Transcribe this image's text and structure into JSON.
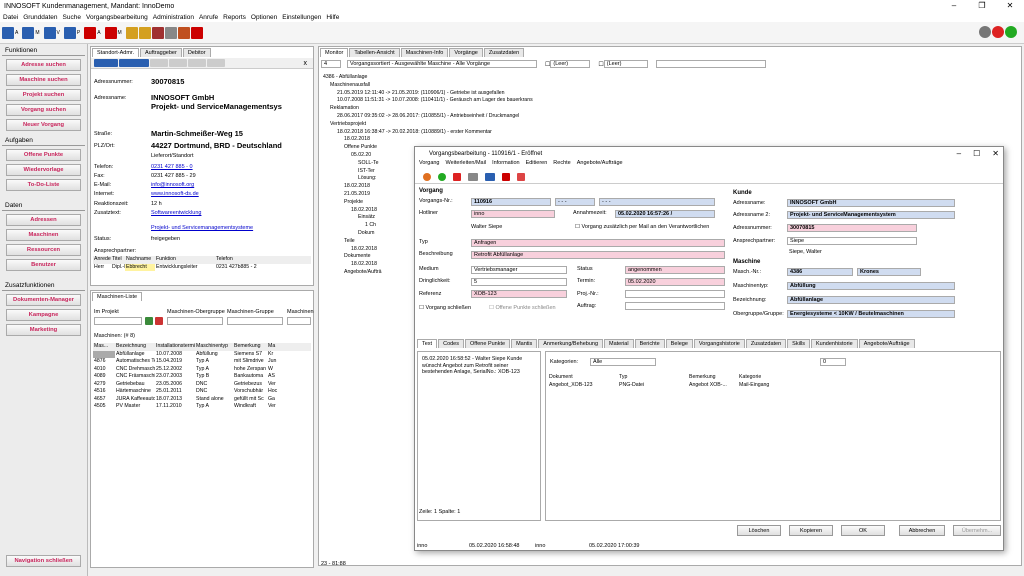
{
  "title": "INNOSOFT Kundenmanagement, Mandant: InnoDemo",
  "menu": [
    "Datei",
    "Grunddaten",
    "Suche",
    "Vorgangsbearbeitung",
    "Administration",
    "Anrufe",
    "Reports",
    "Optionen",
    "Einstellungen",
    "Hilfe"
  ],
  "toolbar": {
    "labels": [
      "A",
      "M",
      "V",
      "P",
      "A",
      "M"
    ]
  },
  "nav": {
    "funktionen": "Funktionen",
    "btns1": [
      "Adresse suchen",
      "Maschine suchen",
      "Projekt suchen",
      "Vorgang suchen",
      "Neuer Vorgang"
    ],
    "aufgaben": "Aufgaben",
    "btns2": [
      "Offene Punkte",
      "Wiedervorlage",
      "To-Do-Liste"
    ],
    "daten": "Daten",
    "btns3": [
      "Adressen",
      "Maschinen",
      "Ressourcen",
      "Benutzer"
    ],
    "zusatz": "Zusatzfunktionen",
    "btns4": [
      "Dokumenten-Manager",
      "Kampagne",
      "Marketing"
    ],
    "close": "Navigation schließen"
  },
  "addr": {
    "tabs": [
      "Standort-Admr.",
      "Auftraggeber",
      "Debitor"
    ],
    "nr_l": "Adressnummer:",
    "nr": "30070815",
    "name_l": "Adressname:",
    "name1": "INNOSOFT GmbH",
    "name2": "Projekt- und ServiceManagementsys",
    "str_l": "Straße:",
    "str": "Martin-Schmeißer-Weg 15",
    "plz_l": "PLZ/Ort:",
    "plz": "44227 Dortmund, BRD - Deutschland",
    "typ": "Lieferort/Standort",
    "tel_l": "Telefon:",
    "tel": "0231 427 885 - 0",
    "fax_l": "Fax:",
    "fax": "0231 427 885 - 29",
    "mail_l": "E-Mail:",
    "mail": "info@innosoft.org",
    "inet_l": "Internet:",
    "inet": "www.innosoft-ds.de",
    "rz_l": "Reaktionszeit:",
    "rz": "12 h",
    "zt_l": "Zusatztext:",
    "zt": "Softwareentwicklung",
    "pl": "Projekt- und Servicemanagementsysteme",
    "status_l": "Status:",
    "status": "freigegeben",
    "ap_l": "Ansprechpartner:",
    "ap_hdr": [
      "Anrede",
      "Titel",
      "Nachname",
      "Funktion",
      "Telefon"
    ],
    "ap_row": [
      "Herr",
      "Dipl.-I",
      "Ebbrecht",
      "Entwicklungsleiter",
      "0231 427b885 - 2"
    ]
  },
  "mach": {
    "tab": "Maschinen-Liste",
    "f1": "Im Projekt",
    "f2": "Maschinen-Obergruppe",
    "f3": "Maschinen-Gruppe",
    "f4": "Maschinen",
    "count": "Maschinen: (# 8)",
    "hdr": [
      "Mas...",
      "Bezeichnung",
      "Installationstermin",
      "Maschinentyp",
      "Bemerkung",
      "Ma"
    ],
    "rows": [
      [
        "",
        "Abfüllanlage",
        "10.07.2008",
        "Abfüllung",
        "Siemens S7",
        "Kr"
      ],
      [
        "4876",
        "Automatisches Te",
        "15.04.2019",
        "Typ A",
        "mit Slimdrive",
        "Jun"
      ],
      [
        "4010",
        "CNC Drehmaschin",
        "25.12.2002",
        "Typ A",
        "hohe Zerspan",
        "W"
      ],
      [
        "4089",
        "CNC Fräsmaschin",
        "23.07.2003",
        "Typ B",
        "Bankautoma",
        "AS"
      ],
      [
        "4279",
        "Getriebebau",
        "23.05.2006",
        "DNC",
        "Getriebezus",
        "Ver"
      ],
      [
        "4516",
        "Härtemaschine",
        "25.01.2011",
        "DNC",
        "Vorschubhär",
        "Hoc"
      ],
      [
        "4657",
        "JURA Kaffeeauto",
        "18.07.2013",
        "Stand alone",
        "gefüllt mit Sc",
        "Ga"
      ],
      [
        "4505",
        "PV Master",
        "17.11.2010",
        "Typ A",
        "Windkraft",
        "Ver"
      ]
    ]
  },
  "monitor": {
    "tabs": [
      "Monitor",
      "Tabellen-Ansicht",
      "Maschinen-Info",
      "Vorgänge",
      "Zusatzdaten"
    ],
    "num": "4",
    "sort": "Vorgangssortiert - Ausgewählte Maschine - Alle Vorgänge",
    "leer1": "(Leer)",
    "leer2": "(Leer)",
    "tree": [
      "4386 - Abfüllanlage",
      "Maschinenausfall",
      "21.05.2019 12:11:40 -> 21.05.2019: (110906/1) - Getriebe ist ausgefallen",
      "10.07.2008 11:51:31 -> 10.07.2008: (110411/1) - Geräusch am Lager des bauerkrans",
      "Reklamation",
      "28.06.2017 09:35:02 -> 28.06.2017: (110855/1) - Antriebseinheit / Druckmangel",
      "Vertriebsprojekt",
      "18.02.2018 16:38:47 -> 20.02.2018: (110889/1) - erster Kommentar",
      "18.02.2018",
      "Offene Punkte",
      "05.02.20",
      "SOLL-Te",
      "IST-Ter",
      "Lösung:",
      "18.02.2018",
      "21.05.2019",
      "Projekte",
      "18.02.2018",
      "Einsätz",
      "1 Ch",
      "Dokum",
      "Teile",
      "18.02.2018",
      "Dokumente",
      "18.02.2018",
      "Angebote/Aufträ"
    ],
    "status": "23 - 81:88"
  },
  "dlg": {
    "title": "Vorgangsbearbeitung - 110916/1 - Eröffnet",
    "menu": [
      "Vorgang",
      "Weiterleiten/Mail",
      "Information",
      "Editieren",
      "Rechte",
      "Angebote/Aufträge"
    ],
    "vorgang": "Vorgang",
    "vnr_l": "Vorgangs-Nr.:",
    "vnr": "110916",
    "hotl_l": "Hotliner",
    "hotl": "inno",
    "annz_l": "Annahmezeit:",
    "annz": "05.02.2020 16:57:26 /",
    "user": "Walter Siepe",
    "chk1": "Vorgang zusätzlich per Mail an den Verantwortlichen",
    "typ_l": "Typ",
    "typ": "Anfragen",
    "bes_l": "Beschreibung",
    "bes": "Retrofit Abfüllanlage",
    "med_l": "Medium",
    "med": "Vertriebsmanager",
    "sta_l": "Status",
    "sta": "angenommen",
    "dri_l": "Dringlichkeit:",
    "dri": "5",
    "ter_l": "Termin:",
    "ter": "05.02.2020",
    "ref_l": "Referenz",
    "ref": "XOB-123",
    "proj_l": "Proj.-Nr.:",
    "auf_l": "Auftrag:",
    "chk2": "Vorgang schließen",
    "chk3": "Offene Punkte schließen",
    "kunde": "Kunde",
    "an_l": "Adressname:",
    "an": "INNOSOFT GmbH",
    "an2_l": "Adressname 2:",
    "an2": "Projekt- und ServiceManagementsystem",
    "anr_l": "Adressnummer:",
    "anr": "30070815",
    "ap_l": "Ansprechpartner:",
    "ap": "Siepe",
    "ap2": "Siepe, Walter",
    "masch": "Maschine",
    "mnr_l": "Masch.-Nr.:",
    "mnr": "4386",
    "mnr2": "Krones",
    "mt_l": "Maschinentyp:",
    "mt": "Abfüllung",
    "bz_l": "Bezeichnung:",
    "bz": "Abfüllanlage",
    "og_l": "Obergruppe/Gruppe:",
    "og": "Energiesysteme < 10KW / Beutelmaschinen",
    "tabs": [
      "Text",
      "Codes",
      "Offene Punkte",
      "Mantis",
      "Anmerkung/Behebung",
      "Material",
      "Berichte",
      "Belege",
      "Vorgangshistorie",
      "Zusatzdaten",
      "Skills",
      "Kundenhistorie",
      "Angebote/Aufträge"
    ],
    "text": "05.02.2020 16:58:52 - Walter Siepe Kunde wünscht Angebot zum Retrofit seiner bestehenden Anlage, SerialNo.: XOB-123",
    "zeile": "Zeile: 1 Spalte: 1",
    "kat_l": "Kategorien:",
    "kat": "Alle",
    "zoom": "0",
    "dhdr": [
      "Dokument",
      "Typ",
      "Bemerkung",
      "Kategorie"
    ],
    "drow": [
      "Angebot_XOB-123",
      "PNG-Datei",
      "Angebot XOB-...",
      "Mail-Eingang"
    ],
    "btns": [
      "Löschen",
      "Kopieren",
      "OK",
      "Abbrechen",
      "Übernehm..."
    ],
    "st1": "inno",
    "st2": "05.02.2020 16:58:48",
    "st3": "inno",
    "st4": "05.02.2020 17:00:39"
  }
}
